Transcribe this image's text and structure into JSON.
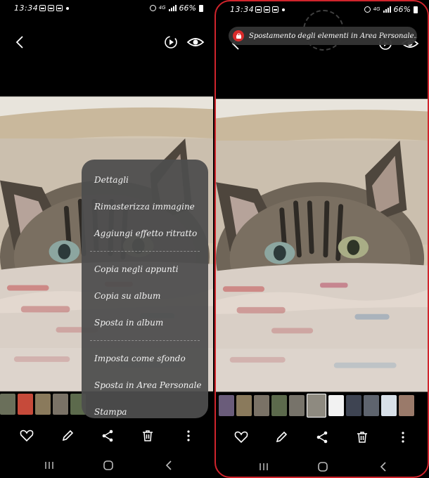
{
  "status": {
    "time": "13:34",
    "network": "4G",
    "battery": "66%"
  },
  "menu": {
    "items": [
      "Dettagli",
      "Rimasterizza immagine",
      "Aggiungi effetto ritratto",
      "Copia negli appunti",
      "Copia su album",
      "Sposta in album",
      "Imposta come sfondo",
      "Sposta in Area Personale",
      "Stampa"
    ]
  },
  "toast": {
    "text": "Spostamento degli elementi in Area Personale..."
  },
  "icons": {
    "back": "chevron-left-icon",
    "remaster": "remaster-icon",
    "visibility": "eye-icon",
    "favorite": "heart-icon",
    "edit": "pencil-icon",
    "share": "share-icon",
    "delete": "trash-icon",
    "more": "more-vertical-icon",
    "recents": "recents-icon",
    "home": "home-icon",
    "nav_back": "nav-back-icon"
  },
  "colors": {
    "highlight_border": "#d0242c",
    "toast_icon": "#d92b2b",
    "menu_bg": "#4e4e4e"
  }
}
